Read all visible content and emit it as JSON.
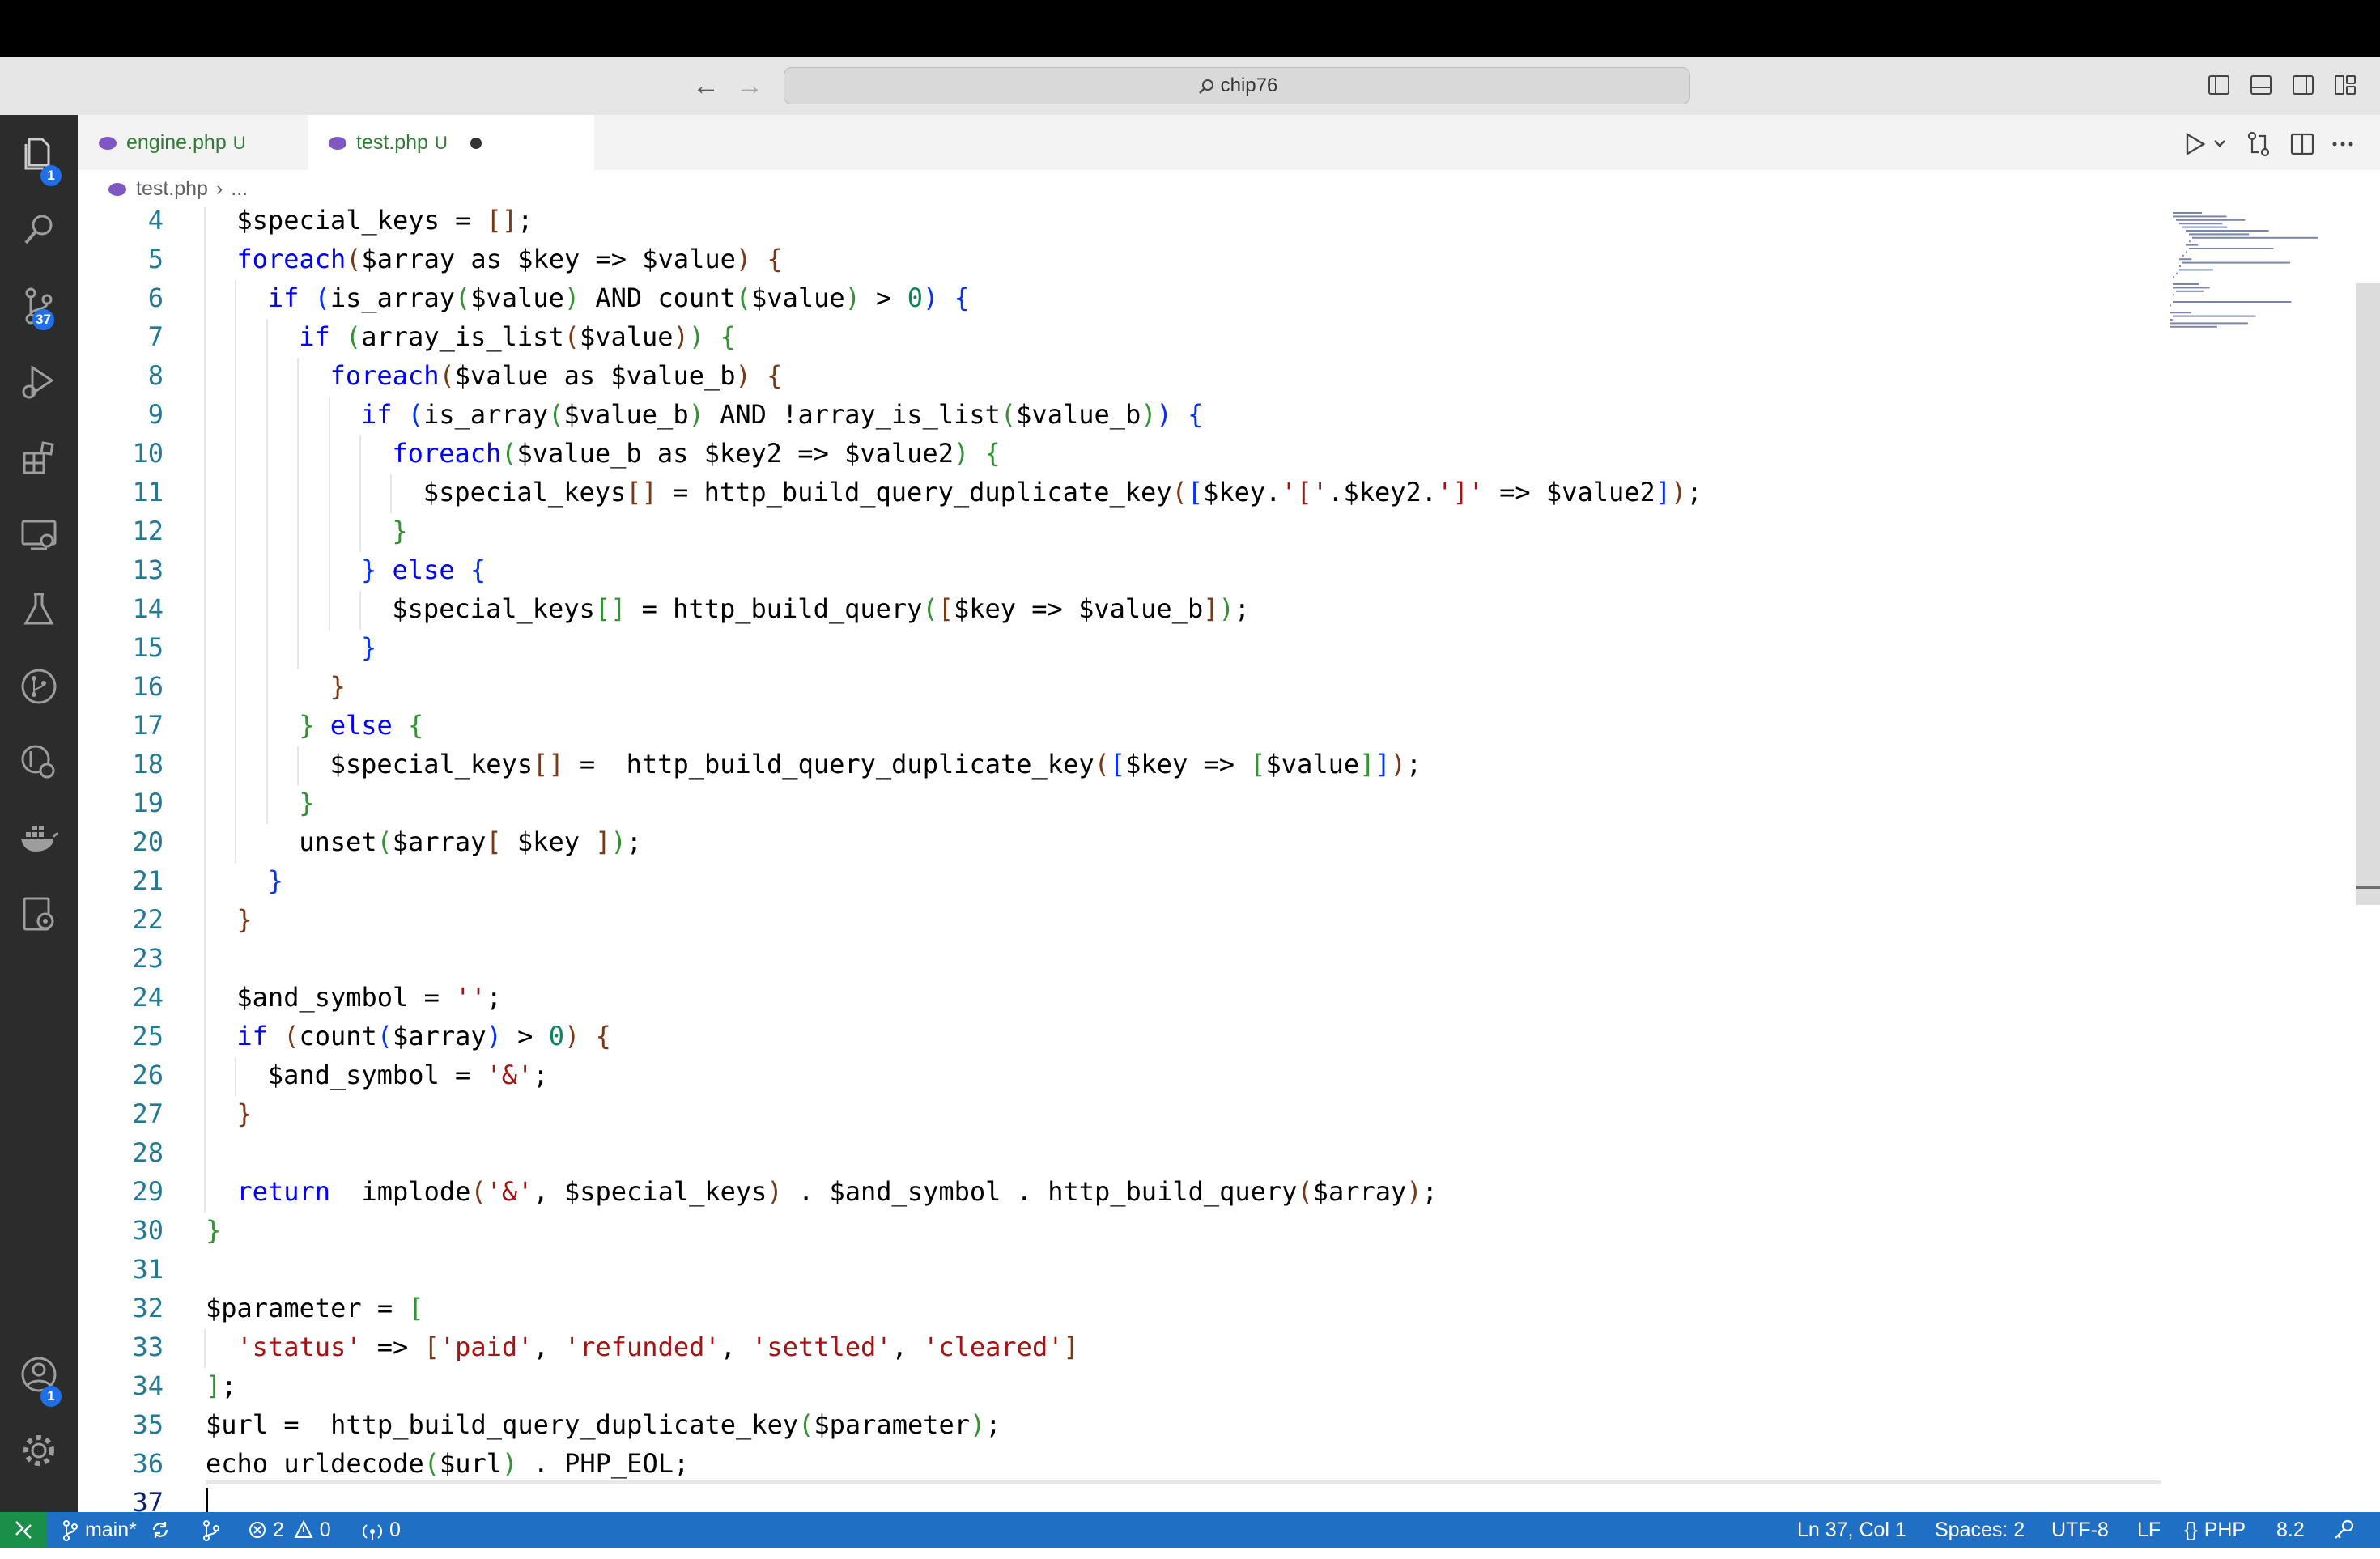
{
  "window": {
    "search_text": "chip76"
  },
  "tabs": [
    {
      "label": "engine.php",
      "status": "U",
      "active": false
    },
    {
      "label": "test.php",
      "status": "U",
      "active": true,
      "unsaved": true
    }
  ],
  "breadcrumb": {
    "file": "test.php",
    "rest": "..."
  },
  "activity_badges": {
    "explorer": "1",
    "source_control": "37",
    "accounts": "1"
  },
  "code": {
    "lines": [
      {
        "n": "4",
        "indent": 1,
        "text": "$special_keys = [];"
      },
      {
        "n": "5",
        "indent": 1,
        "text": "foreach($array as $key => $value) {"
      },
      {
        "n": "6",
        "indent": 2,
        "text": "if (is_array($value) AND count($value) > 0) {"
      },
      {
        "n": "7",
        "indent": 3,
        "text": "if (array_is_list($value)) {"
      },
      {
        "n": "8",
        "indent": 4,
        "text": "foreach($value as $value_b) {"
      },
      {
        "n": "9",
        "indent": 5,
        "text": "if (is_array($value_b) AND !array_is_list($value_b)) {"
      },
      {
        "n": "10",
        "indent": 6,
        "text": "foreach($value_b as $key2 => $value2) {"
      },
      {
        "n": "11",
        "indent": 7,
        "text": "$special_keys[] = http_build_query_duplicate_key([$key.'['.$key2.']' => $value2]);"
      },
      {
        "n": "12",
        "indent": 6,
        "text": "}"
      },
      {
        "n": "13",
        "indent": 5,
        "text": "} else {"
      },
      {
        "n": "14",
        "indent": 6,
        "text": "$special_keys[] = http_build_query([$key => $value_b]);"
      },
      {
        "n": "15",
        "indent": 5,
        "text": "}"
      },
      {
        "n": "16",
        "indent": 4,
        "text": "}"
      },
      {
        "n": "17",
        "indent": 3,
        "text": "} else {"
      },
      {
        "n": "18",
        "indent": 4,
        "text": "$special_keys[] =  http_build_query_duplicate_key([$key => [$value]]);"
      },
      {
        "n": "19",
        "indent": 3,
        "text": "}"
      },
      {
        "n": "20",
        "indent": 3,
        "text": "unset($array[ $key ]);"
      },
      {
        "n": "21",
        "indent": 2,
        "text": "}"
      },
      {
        "n": "22",
        "indent": 1,
        "text": "}"
      },
      {
        "n": "23",
        "indent": 1,
        "text": ""
      },
      {
        "n": "24",
        "indent": 1,
        "text": "$and_symbol = '';"
      },
      {
        "n": "25",
        "indent": 1,
        "text": "if (count($array) > 0) {"
      },
      {
        "n": "26",
        "indent": 2,
        "text": "$and_symbol = '&';"
      },
      {
        "n": "27",
        "indent": 1,
        "text": "}"
      },
      {
        "n": "28",
        "indent": 1,
        "text": ""
      },
      {
        "n": "29",
        "indent": 1,
        "text": "return  implode('&', $special_keys) . $and_symbol . http_build_query($array);"
      },
      {
        "n": "30",
        "indent": 0,
        "text": "}"
      },
      {
        "n": "31",
        "indent": 0,
        "text": ""
      },
      {
        "n": "32",
        "indent": 0,
        "text": "$parameter = ["
      },
      {
        "n": "33",
        "indent": 1,
        "text": "'status' => ['paid', 'refunded', 'settled', 'cleared']"
      },
      {
        "n": "34",
        "indent": 0,
        "text": "];"
      },
      {
        "n": "35",
        "indent": 0,
        "text": "$url =  http_build_query_duplicate_key($parameter);"
      },
      {
        "n": "36",
        "indent": 0,
        "text": "echo urldecode($url) . PHP_EOL;"
      },
      {
        "n": "37",
        "indent": 0,
        "text": ""
      }
    ]
  },
  "statusbar": {
    "branch": "main*",
    "errors": "2",
    "warnings": "0",
    "ports": "0",
    "position": "Ln 37, Col 1",
    "spaces": "Spaces: 2",
    "encoding": "UTF-8",
    "eol": "LF",
    "language": "PHP",
    "version": "8.2"
  },
  "colors": {
    "keyword": "#0000ff",
    "variable": "#001080",
    "string": "#a31515",
    "number": "#098658",
    "bracket1": "#0431fa",
    "bracket2": "#319331",
    "bracket3": "#7b3814",
    "statusbar": "#1f6fc4"
  }
}
